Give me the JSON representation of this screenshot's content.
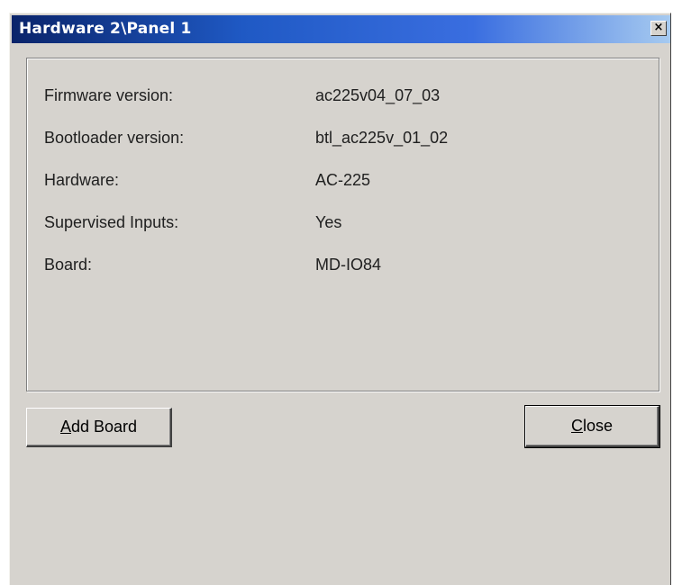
{
  "window": {
    "title": "Hardware 2\\Panel 1",
    "close_glyph": "×"
  },
  "info": {
    "rows": [
      {
        "label": "Firmware version:",
        "value": "ac225v04_07_03"
      },
      {
        "label": "Bootloader version:",
        "value": "btl_ac225v_01_02"
      },
      {
        "label": "Hardware:",
        "value": "AC-225"
      },
      {
        "label": "Supervised Inputs:",
        "value": "Yes"
      },
      {
        "label": "Board:",
        "value": "MD-IO84"
      }
    ]
  },
  "buttons": {
    "add_board": {
      "mnemonic": "A",
      "rest": "dd Board"
    },
    "close": {
      "mnemonic": "C",
      "rest": "lose"
    }
  },
  "colors": {
    "titlebar_start": "#0a246a",
    "titlebar_end": "#a6caf0",
    "window_face": "#d6d3ce"
  }
}
